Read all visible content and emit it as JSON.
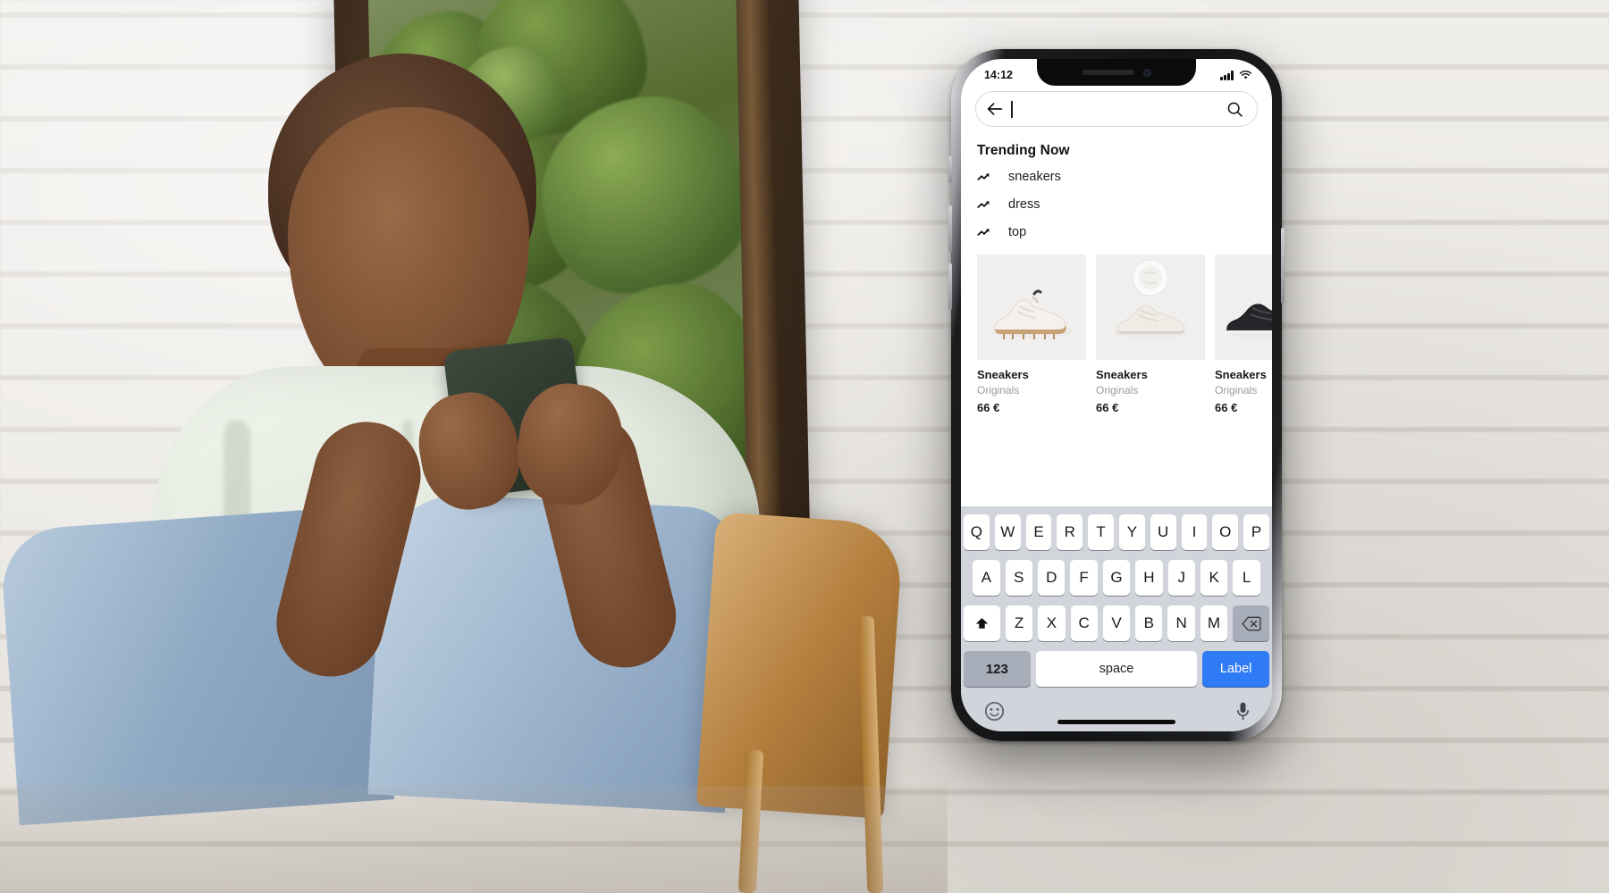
{
  "background": {
    "description": "woman-sitting-with-phone-photo",
    "alt": "Woman seated on wooden chair using a smartphone in front of a white brick wall and window"
  },
  "phone": {
    "status_bar": {
      "time": "14:12",
      "signal_icon": "cellular-signal-icon",
      "wifi_icon": "wifi-icon"
    },
    "search": {
      "back_icon": "back-arrow-icon",
      "value": "",
      "placeholder": "",
      "search_icon": "search-icon"
    },
    "trending": {
      "title": "Trending Now",
      "items": [
        {
          "icon": "trend-up-icon",
          "label": "sneakers"
        },
        {
          "icon": "trend-up-icon",
          "label": "dress"
        },
        {
          "icon": "trend-up-icon",
          "label": "top"
        }
      ]
    },
    "products": [
      {
        "image": "white-chunky-sneaker",
        "name": "Sneakers",
        "brand": "Originals",
        "price": "66 €"
      },
      {
        "image": "beige-low-sneaker",
        "name": "Sneakers",
        "brand": "Originals",
        "price": "66 €"
      },
      {
        "image": "black-sneaker",
        "name": "Sneakers",
        "brand": "Originals",
        "price": "66 €"
      }
    ],
    "keyboard": {
      "row1": [
        "Q",
        "W",
        "E",
        "R",
        "T",
        "Y",
        "U",
        "I",
        "O",
        "P"
      ],
      "row2": [
        "A",
        "S",
        "D",
        "F",
        "G",
        "H",
        "J",
        "K",
        "L"
      ],
      "row3_shift_icon": "shift-up-icon",
      "row3": [
        "Z",
        "X",
        "C",
        "V",
        "B",
        "N",
        "M"
      ],
      "row3_backspace_icon": "backspace-icon",
      "numbers_key": "123",
      "space_key": "space",
      "action_key": "Label",
      "emoji_icon": "emoji-smiley-icon",
      "mic_icon": "microphone-icon",
      "accent_color": "#2f7bf6"
    },
    "home_indicator": "home-indicator-bar"
  }
}
